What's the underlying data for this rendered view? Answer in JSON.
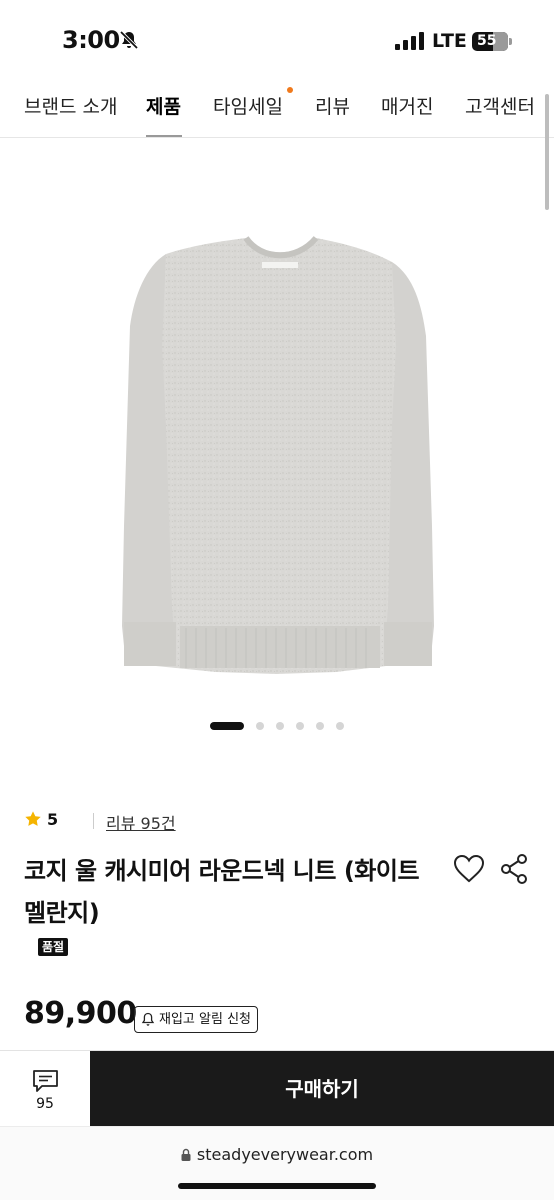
{
  "status_bar": {
    "time": "3:00",
    "network": "LTE",
    "battery": "55"
  },
  "nav": {
    "items": [
      {
        "label": "브랜드 소개"
      },
      {
        "label": "제품"
      },
      {
        "label": "타임세일"
      },
      {
        "label": "리뷰"
      },
      {
        "label": "매거진"
      },
      {
        "label": "고객센터"
      }
    ],
    "active_index": 1,
    "badge_color": "#f07a1c"
  },
  "gallery": {
    "image": "light-gray-melange-crewneck-sweater",
    "total_slides": 6,
    "current_slide": 1
  },
  "rating": {
    "icon": "star-icon",
    "score": "5",
    "review_link": "리뷰 95건"
  },
  "product": {
    "title": "코지 울 캐시미어 라운드넥 니트 (화이트 멜란지)",
    "badge": "품절",
    "price": "89,900",
    "restock_label": "재입고 알림 신청"
  },
  "bottom_bar": {
    "review_count": "95",
    "buy_label": "구매하기"
  },
  "browser": {
    "url": "steadyeverywear.com"
  },
  "colors": {
    "accent": "#f07a1c",
    "buy_button": "#1a1a1a"
  }
}
